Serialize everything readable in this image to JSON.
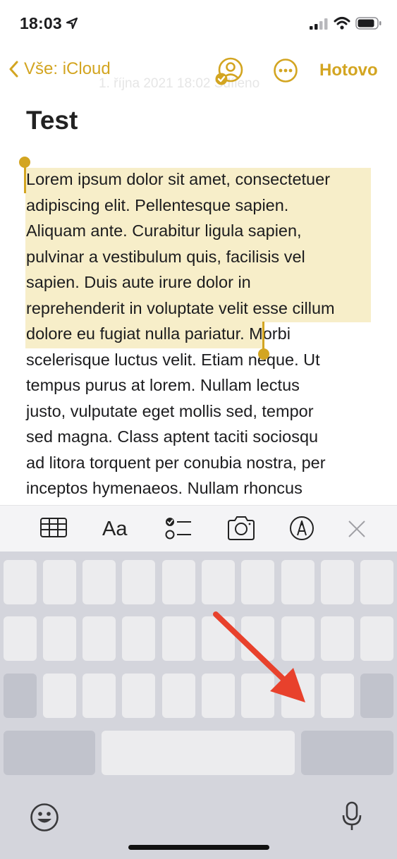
{
  "status": {
    "time": "18:03"
  },
  "nav": {
    "back_label": "Vše: iCloud",
    "faded_date": "1. října 2021 18:02 Sdíleno",
    "done_label": "Hotovo"
  },
  "note": {
    "title": "Test",
    "body": "Lorem ipsum dolor sit amet, consectetuer\nadipiscing elit. Pellentesque sapien.\nAliquam ante. Curabitur ligula sapien,\npulvinar a vestibulum quis, facilisis vel\nsapien. Duis aute irure dolor in\nreprehenderit in voluptate velit esse cillum\ndolore eu fugiat nulla pariatur. Morbi\nscelerisque luctus velit. Etiam neque. Ut\ntempus purus at lorem. Nullam lectus\njusto, vulputate eget mollis sed, tempor\nsed magna. Class aptent taciti sociosqu\nad litora torquent per conubia nostra, per\ninceptos hymenaeos. Nullam rhoncus"
  },
  "toolbar": {
    "format_label": "Aa",
    "icons": [
      "table-icon",
      "checklist-icon",
      "camera-icon",
      "markup-icon",
      "close-icon"
    ]
  },
  "colors": {
    "accent": "#d3a521",
    "selection": "#f7eec9",
    "annotation_arrow": "#e8412c",
    "keyboard_bg": "#d4d5dc"
  }
}
